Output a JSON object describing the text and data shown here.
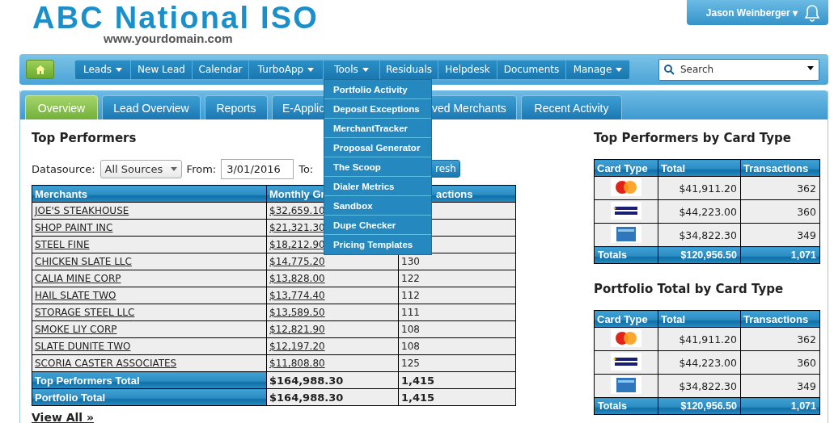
{
  "header": {
    "logo": "ABC National ISO",
    "domain": "www.yourdomain.com",
    "user": {
      "name": "Jason Weinberger ▾"
    }
  },
  "nav": {
    "items": [
      {
        "label": "Leads",
        "dropdown": true
      },
      {
        "label": "New Lead",
        "dropdown": false
      },
      {
        "label": "Calendar",
        "dropdown": false
      },
      {
        "label": "TurboApp",
        "dropdown": true
      },
      {
        "label": "Tools",
        "dropdown": true
      },
      {
        "label": "Residuals",
        "dropdown": false
      },
      {
        "label": "Helpdesk",
        "dropdown": false
      },
      {
        "label": "Documents",
        "dropdown": false
      },
      {
        "label": "Manage",
        "dropdown": true
      }
    ],
    "search": {
      "placeholder": "Search"
    },
    "tools_menu": [
      "Portfolio Activity",
      "Deposit Exceptions",
      "MerchantTracker",
      "Proposal Generator",
      "The Scoop",
      "Dialer Metrics",
      "Sandbox",
      "Dupe Checker",
      "Pricing Templates"
    ]
  },
  "tabs": [
    {
      "label": "Overview",
      "selected": true
    },
    {
      "label": "Lead Overview",
      "selected": false
    },
    {
      "label": "Reports",
      "selected": false
    },
    {
      "label": "E-Applic",
      "selected": false
    },
    {
      "label": "ved Merchants",
      "selected": false
    },
    {
      "label": "Recent Activity",
      "selected": false
    }
  ],
  "top_performers": {
    "title": "Top Performers",
    "datasource_label": "Datasource:",
    "datasource": "All Sources",
    "from_label": "From:",
    "from": "3/01/2016",
    "to_label": "To:",
    "refresh": "resh",
    "columns": [
      "Merchants",
      "Monthly Gr",
      "actions"
    ],
    "rows": [
      {
        "merchant": "JOE'S STEAKHOUSE",
        "monthly": "$32,659.10"
      },
      {
        "merchant": "SHOP PAINT INC",
        "monthly": "$21,321.30"
      },
      {
        "merchant": "STEEL FINE",
        "monthly": "$18,212.90"
      },
      {
        "merchant": "CHICKEN SLATE LLC",
        "monthly": "$14,775.20",
        "transactions": "130"
      },
      {
        "merchant": "CALIA MINE CORP",
        "monthly": "$13,828.00",
        "transactions": "122"
      },
      {
        "merchant": "HAIL SLATE TWO",
        "monthly": "$13,774.40",
        "transactions": "112"
      },
      {
        "merchant": "STORAGE STEEL LLC",
        "monthly": "$13,589.50",
        "transactions": "111"
      },
      {
        "merchant": "SMOKE LIY CORP",
        "monthly": "$12,821.90",
        "transactions": "108"
      },
      {
        "merchant": "SLATE DUNITE TWO",
        "monthly": "$12,197.20",
        "transactions": "108"
      },
      {
        "merchant": "SCORIA CASTER ASSOCIATES",
        "monthly": "$11,808.80",
        "transactions": "125"
      }
    ],
    "totals": [
      {
        "label": "Top Performers Total",
        "monthly": "$164,988.30",
        "transactions": "1,415"
      },
      {
        "label": "Portfolio Total",
        "monthly": "$164,988.30",
        "transactions": "1,415"
      }
    ],
    "view_all": "View All »"
  },
  "card_tables": [
    {
      "title": "Top Performers by Card Type",
      "columns": [
        "Card Type",
        "Total",
        "Transactions"
      ],
      "rows": [
        {
          "kind": "mastercard",
          "total": "$41,911.20",
          "transactions": "362"
        },
        {
          "kind": "visa",
          "total": "$44,223.00",
          "transactions": "360"
        },
        {
          "kind": "amex",
          "total": "$34,822.30",
          "transactions": "349"
        }
      ],
      "totals": {
        "label": "Totals",
        "total": "$120,956.50",
        "transactions": "1,071"
      }
    },
    {
      "title": "Portfolio Total by Card Type",
      "columns": [
        "Card Type",
        "Total",
        "Transactions"
      ],
      "rows": [
        {
          "kind": "mastercard",
          "total": "$41,911.20",
          "transactions": "362"
        },
        {
          "kind": "visa",
          "total": "$44,223.00",
          "transactions": "360"
        },
        {
          "kind": "amex",
          "total": "$34,822.30",
          "transactions": "349"
        }
      ],
      "totals": {
        "label": "Totals",
        "total": "$120,956.50",
        "transactions": "1,071"
      }
    }
  ]
}
